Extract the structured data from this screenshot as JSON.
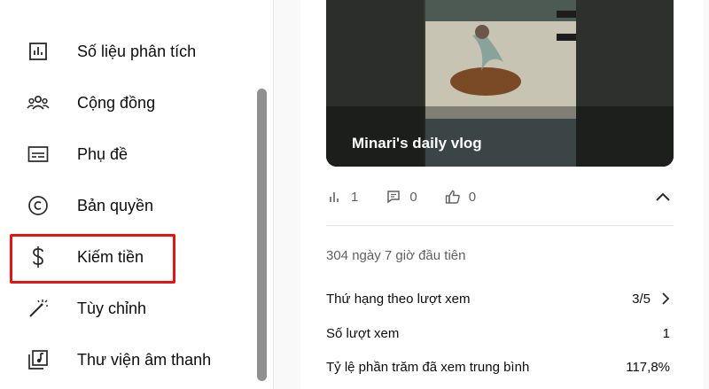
{
  "sidebar": {
    "items": [
      {
        "label": "Số liệu phân tích",
        "icon": "analytics-icon"
      },
      {
        "label": "Cộng đồng",
        "icon": "community-icon"
      },
      {
        "label": "Phụ đề",
        "icon": "subtitles-icon"
      },
      {
        "label": "Bản quyền",
        "icon": "copyright-icon"
      },
      {
        "label": "Kiếm tiền",
        "icon": "dollar-icon"
      },
      {
        "label": "Tùy chỉnh",
        "icon": "magic-wand-icon"
      },
      {
        "label": "Thư viện âm thanh",
        "icon": "audio-library-icon"
      }
    ],
    "highlighted": "Kiếm tiền"
  },
  "video": {
    "title": "Minari's daily vlog",
    "views": "1",
    "comments": "0",
    "likes": "0"
  },
  "stats": {
    "period": "304 ngày 7 giờ đầu tiên",
    "rows": [
      {
        "label": "Thứ hạng theo lượt xem",
        "value": "3/5",
        "has_chevron": true
      },
      {
        "label": "Số lượt xem",
        "value": "1",
        "has_chevron": false
      },
      {
        "label": "Tỷ lệ phần trăm đã xem trung bình",
        "value": "117,8%",
        "has_chevron": false
      }
    ]
  },
  "colors": {
    "highlight": "#e31414",
    "accent_text": "#0d0d0d",
    "muted_text": "#606060"
  }
}
